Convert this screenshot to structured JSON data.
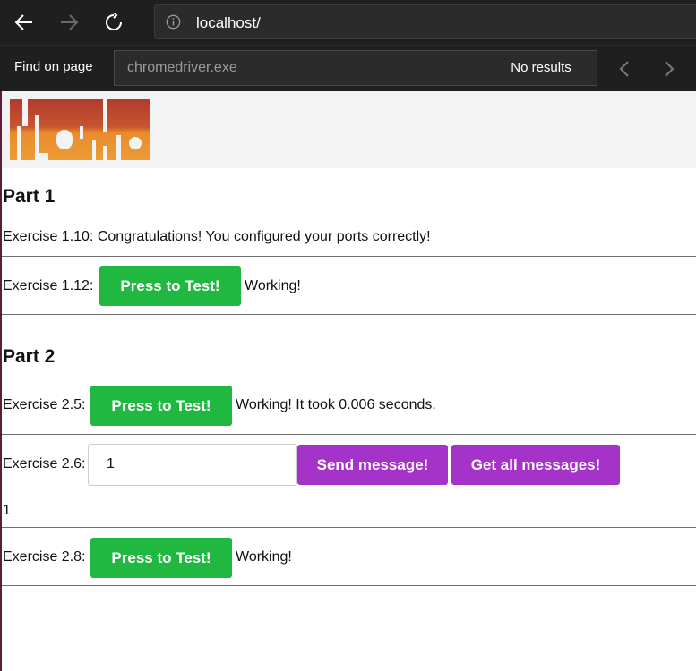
{
  "browser": {
    "url": "localhost/",
    "find_label": "Find on page",
    "find_query": "chromedriver.exe",
    "find_results": "No results"
  },
  "page": {
    "logo_text": "toska",
    "part1": {
      "heading": "Part 1",
      "ex110": {
        "label": "Exercise 1.10:",
        "text": "Congratulations! You configured your ports correctly!"
      },
      "ex112": {
        "label": "Exercise 1.12:",
        "button": "Press to Test!",
        "status": "Working!"
      }
    },
    "part2": {
      "heading": "Part 2",
      "ex25": {
        "label": "Exercise 2.5:",
        "button": "Press to Test!",
        "status": "Working! It took 0.006 seconds."
      },
      "ex26": {
        "label": "Exercise 2.6:",
        "input_value": "1",
        "send_button": "Send message!",
        "get_button": "Get all messages!",
        "messages": "1"
      },
      "ex28": {
        "label": "Exercise 2.8:",
        "button": "Press to Test!",
        "status": "Working!"
      }
    }
  },
  "colors": {
    "chrome_bg": "#1f1f1f",
    "green_button": "#20b840",
    "purple_button": "#a633c9",
    "logo_red": "#b23a2e",
    "logo_orange": "#e98c2c"
  }
}
